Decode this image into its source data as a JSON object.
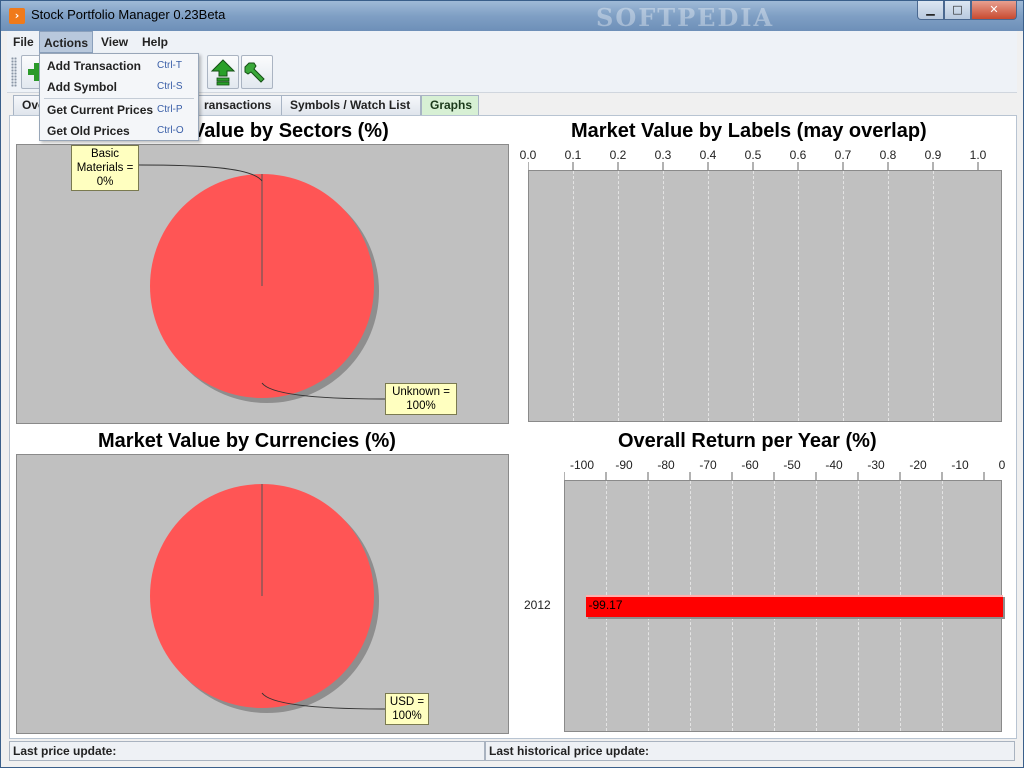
{
  "window": {
    "title": "Stock Portfolio Manager 0.23Beta",
    "watermark": "SOFTPEDIA"
  },
  "menubar": {
    "file": "File",
    "actions": "Actions",
    "view": "View",
    "help": "Help"
  },
  "actions_menu": {
    "items": [
      {
        "label": "Add Transaction",
        "shortcut": "Ctrl-T"
      },
      {
        "label": "Add Symbol",
        "shortcut": "Ctrl-S"
      },
      {
        "label": "Get Current Prices",
        "shortcut": "Ctrl-P"
      },
      {
        "label": "Get Old Prices",
        "shortcut": "Ctrl-O"
      }
    ]
  },
  "toolbar": {
    "icons": [
      "add-icon",
      "download-prices-icon",
      "settings-wrench-icon"
    ]
  },
  "tabs": [
    "Ove",
    "ransactions",
    "Symbols / Watch List",
    "Graphs"
  ],
  "charts": {
    "sectors": {
      "title": "Value by Sectors (%)",
      "labels": [
        {
          "lines": [
            "Basic",
            "Materials =",
            "0%"
          ]
        },
        {
          "lines": [
            "Unknown =",
            "100%"
          ]
        }
      ]
    },
    "labels": {
      "title": "Market Value by Labels (may overlap)",
      "ticks": [
        "0.0",
        "0.1",
        "0.2",
        "0.3",
        "0.4",
        "0.5",
        "0.6",
        "0.7",
        "0.8",
        "0.9",
        "1.0"
      ]
    },
    "currencies": {
      "title": "Market Value by Currencies (%)",
      "labels": [
        {
          "lines": [
            "USD =",
            "100%"
          ]
        }
      ]
    },
    "returns": {
      "title": "Overall Return per Year (%)",
      "ticks": [
        "-100",
        "-90",
        "-80",
        "-70",
        "-60",
        "-50",
        "-40",
        "-30",
        "-20",
        "-10",
        "0"
      ],
      "category": "2012",
      "value_label": "-99.17"
    }
  },
  "chart_data": [
    {
      "type": "pie",
      "title": "Value by Sectors (%)",
      "slices": [
        {
          "label": "Basic Materials",
          "value": 0
        },
        {
          "label": "Unknown",
          "value": 100
        }
      ],
      "color": "#ff5555"
    },
    {
      "type": "bar",
      "title": "Market Value by Labels (may overlap)",
      "xlim": [
        0.0,
        1.0
      ],
      "categories": [],
      "values": []
    },
    {
      "type": "pie",
      "title": "Market Value by Currencies (%)",
      "slices": [
        {
          "label": "USD",
          "value": 100
        }
      ],
      "color": "#ff5555"
    },
    {
      "type": "bar",
      "title": "Overall Return per Year (%)",
      "orientation": "horizontal",
      "categories": [
        "2012"
      ],
      "values": [
        -99.17
      ],
      "xlim": [
        -100,
        0
      ],
      "color": "#ff0000"
    }
  ],
  "colors": {
    "plot_bg": "#c0c0c0",
    "pie": "#ff5555",
    "bar": "#ff0000",
    "label_bg": "#ffffc0"
  },
  "status": {
    "last_price": "Last price update:",
    "last_historical": "Last historical price update:"
  }
}
